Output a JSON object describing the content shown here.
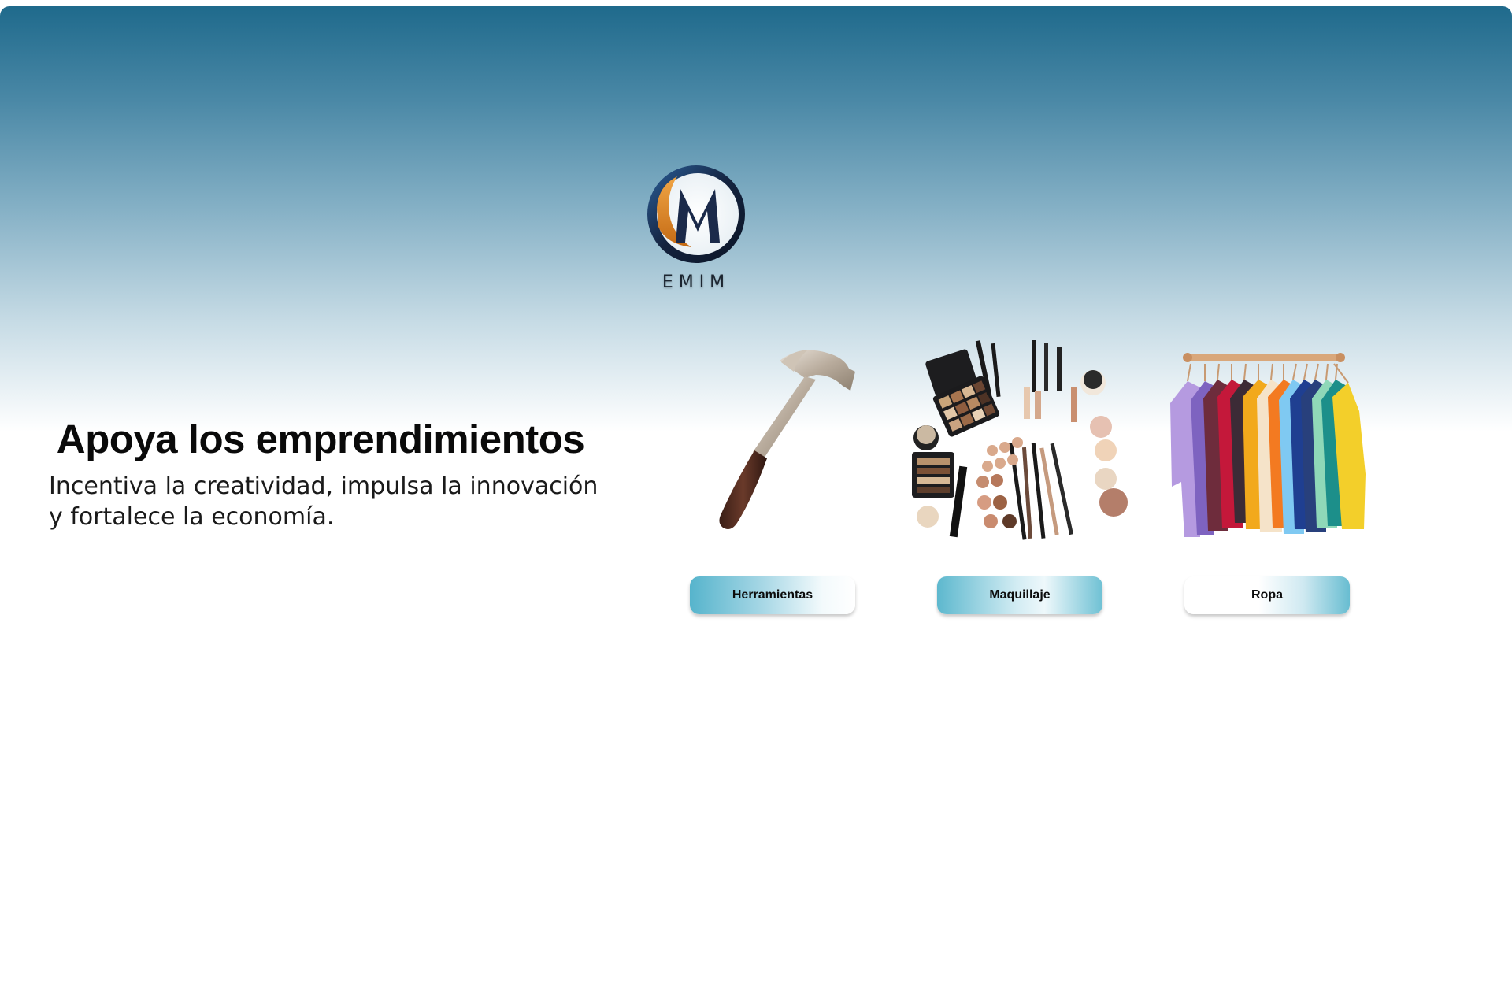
{
  "brand": {
    "logo_text": "EMIM",
    "colors": {
      "navy": "#1b2a4a",
      "orange": "#e28a2b",
      "sky": "#1f6a8c"
    }
  },
  "hero": {
    "headline": "Apoya los emprendimientos",
    "subtitle_line1": "Incentiva la creatividad, impulsa la innovación",
    "subtitle_line2": "y fortalece la economía."
  },
  "categories": [
    {
      "label": "Herramientas",
      "image": "hammer-image"
    },
    {
      "label": "Maquillaje",
      "image": "makeup-image"
    },
    {
      "label": "Ropa",
      "image": "clothes-rack-image"
    }
  ]
}
